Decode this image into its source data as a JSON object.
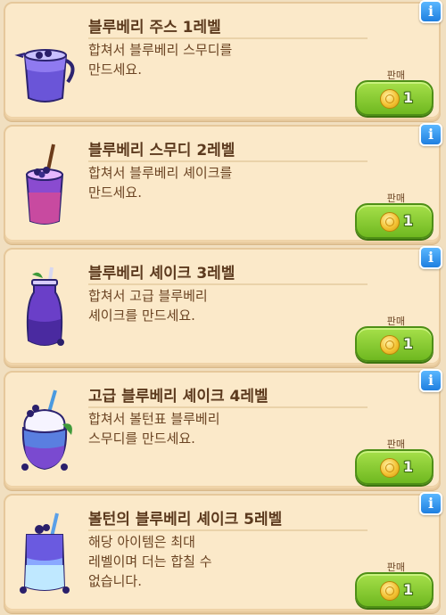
{
  "items": [
    {
      "title": "블루베리 주스 1레벨",
      "desc": [
        "합쳐서 블루베리 스무디를",
        "만드세요."
      ],
      "sell_label": "판매",
      "price": "1",
      "icon": "blueberry-juice-pitcher-icon"
    },
    {
      "title": "블루베리 스무디 2레벨",
      "desc": [
        "합쳐서 블루베리 셰이크를",
        "만드세요."
      ],
      "sell_label": "판매",
      "price": "1",
      "icon": "blueberry-smoothie-cup-icon"
    },
    {
      "title": "블루베리 셰이크 3레벨",
      "desc": [
        "합쳐서 고급 블루베리",
        "셰이크를 만드세요."
      ],
      "sell_label": "판매",
      "price": "1",
      "icon": "blueberry-shake-bottle-icon"
    },
    {
      "title": "고급 블루베리 셰이크 4레벨",
      "desc": [
        "합쳐서 볼턴표 블루베리",
        "스무디를 만드세요."
      ],
      "sell_label": "판매",
      "price": "1",
      "icon": "premium-blueberry-shake-jar-icon"
    },
    {
      "title": "볼턴의 블루베리 셰이크 5레벨",
      "desc": [
        "해당 아이템은 최대",
        "레벨이며 더는 합칠 수",
        "없습니다."
      ],
      "sell_label": "판매",
      "price": "1",
      "icon": "bolton-blueberry-shake-box-icon"
    }
  ],
  "info_symbol": "i",
  "colors": {
    "card_bg": "#fbe9c9",
    "title": "#5c3a1e",
    "sell_button": "#7cc52a",
    "info_button": "#2a8ef0",
    "blueberry": "#5a3fb8"
  }
}
